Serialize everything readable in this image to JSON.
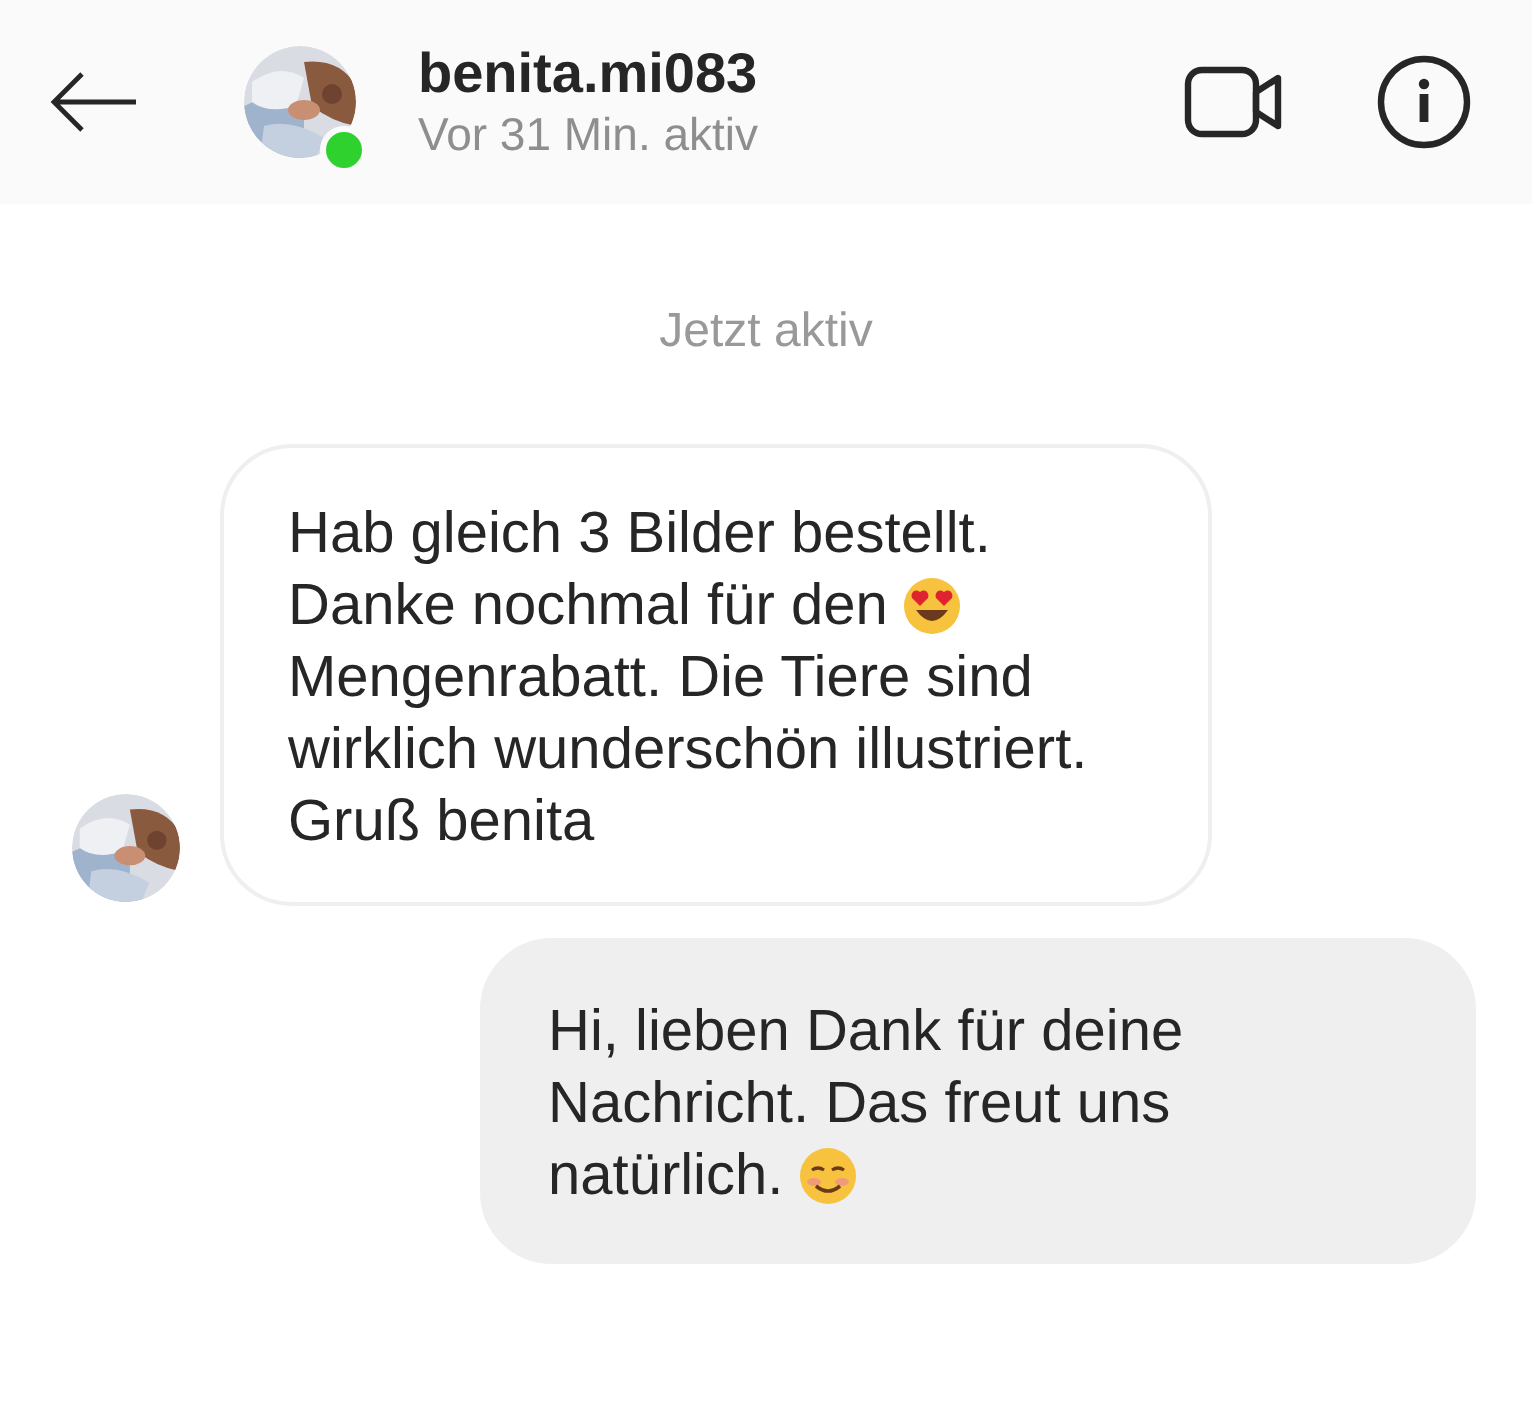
{
  "header": {
    "username": "benita.mi083",
    "status": "Vor 31 Min. aktiv",
    "online": true
  },
  "activity_note": "Jetzt aktiv",
  "messages": [
    {
      "from_me": false,
      "lines": [
        {
          "kind": "plain",
          "text": "Hab gleich 3 Bilder bestellt."
        },
        {
          "kind": "hearteyes",
          "text": "Danke nochmal für den"
        },
        {
          "kind": "plain",
          "text": "Mengenrabatt. Die Tiere sind"
        },
        {
          "kind": "plain",
          "text": "wirklich wunderschön illustriert."
        },
        {
          "kind": "plain",
          "text": "Gruß benita"
        }
      ]
    },
    {
      "from_me": true,
      "lines": [
        {
          "kind": "plain",
          "text": "Hi, lieben Dank für deine"
        },
        {
          "kind": "plain",
          "text": "Nachricht. Das freut uns"
        },
        {
          "kind": "smile",
          "text": "natürlich."
        }
      ]
    }
  ]
}
